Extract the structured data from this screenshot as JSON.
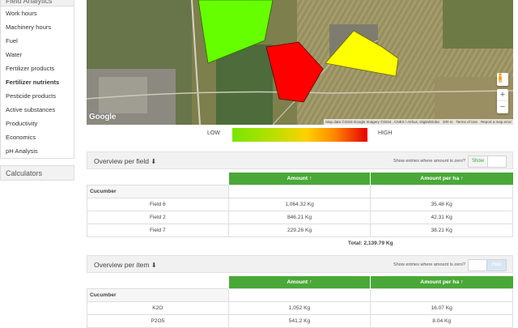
{
  "sidebar": {
    "header": "Field Analytics",
    "items": [
      {
        "label": "Work hours",
        "active": false
      },
      {
        "label": "Machinery hours",
        "active": false
      },
      {
        "label": "Fuel",
        "active": false
      },
      {
        "label": "Water",
        "active": false
      },
      {
        "label": "Fertilizer products",
        "active": false
      },
      {
        "label": "Fertilizer nutrients",
        "active": true
      },
      {
        "label": "Pesticide products",
        "active": false
      },
      {
        "label": "Active substances",
        "active": false
      },
      {
        "label": "Productivity",
        "active": false
      },
      {
        "label": "Economics",
        "active": false
      },
      {
        "label": "pH Analysis",
        "active": false
      }
    ],
    "calculators": "Calculators"
  },
  "map": {
    "google": "Google",
    "attribution": "Map data ©2018 Google Imagery ©2018 , CNES / Airbus, DigitalGlobe",
    "scale": "200 m",
    "terms": "Terms of Use",
    "report": "Report a map error",
    "zoom_in": "+",
    "zoom_out": "−",
    "colors": {
      "green": "#66ff00",
      "red": "#ff0000",
      "yellow": "#ffff00"
    }
  },
  "legend": {
    "low": "LOW",
    "high": "HIGH"
  },
  "overview_field": {
    "title": "Overview per field",
    "title_arrow": "⬇",
    "zeros_label": "Show entries where amount is zero?",
    "toggle_label": "Show",
    "columns": [
      "Amount ↑",
      "Amount per ha ↑"
    ],
    "group": "Cucumber",
    "rows": [
      {
        "name": "Field 6",
        "amount": "1,064.32 Kg",
        "per_ha": "35.48 Kg"
      },
      {
        "name": "Field 2",
        "amount": "846.21 Kg",
        "per_ha": "42.31 Kg"
      },
      {
        "name": "Field 7",
        "amount": "229.26 Kg",
        "per_ha": "38.21 Kg"
      }
    ],
    "total": "Total: 2,139.79 Kg"
  },
  "overview_item": {
    "title": "Overview per item",
    "title_arrow": "⬇",
    "zeros_label": "Show entries where amount is zero?",
    "toggle_label": "Hide",
    "columns": [
      "Amount ↑",
      "Amount per ha ↑"
    ],
    "group": "Cucumber",
    "rows": [
      {
        "name": "K2O",
        "amount": "1,052 Kg",
        "per_ha": "16.07 Kg"
      },
      {
        "name": "P2O5",
        "amount": "541.2 Kg",
        "per_ha": "8.04 Kg"
      }
    ]
  }
}
